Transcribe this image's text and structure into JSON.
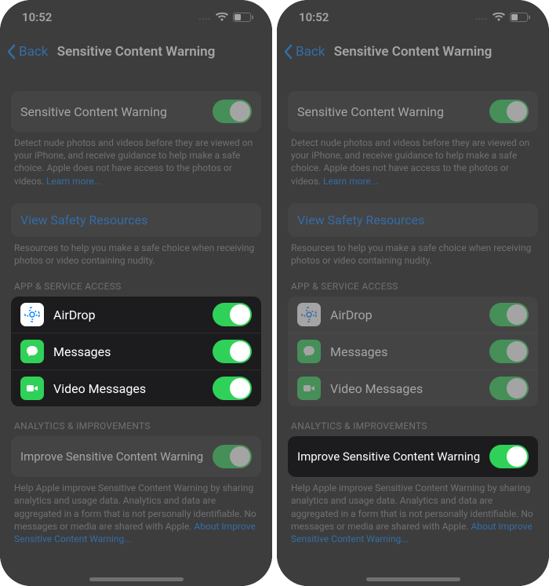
{
  "status": {
    "time": "10:52",
    "dots": "...."
  },
  "nav": {
    "back": "Back",
    "title": "Sensitive Content Warning"
  },
  "main_toggle": {
    "label": "Sensitive Content Warning",
    "on": true
  },
  "main_footer": {
    "text": "Detect nude photos and videos before they are viewed on your iPhone, and receive guidance to help make a safe choice. Apple does not have access to the photos or videos.",
    "link": "Learn more..."
  },
  "resources": {
    "label": "View Safety Resources",
    "footer": "Resources to help you make a safe choice when receiving photos or video containing nudity."
  },
  "apps_header": "APP & SERVICE ACCESS",
  "apps": [
    {
      "name": "AirDrop",
      "icon": "airdrop",
      "on": true
    },
    {
      "name": "Messages",
      "icon": "messages",
      "on": true
    },
    {
      "name": "Video Messages",
      "icon": "video",
      "on": true
    }
  ],
  "analytics_header": "ANALYTICS & IMPROVEMENTS",
  "analytics": {
    "label": "Improve Sensitive Content Warning",
    "on": true
  },
  "analytics_footer": {
    "text": "Help Apple improve Sensitive Content Warning by sharing analytics and usage data. Analytics and data are aggregated in a form that is not personally identifiable. No messages or media are shared with Apple.",
    "link": "About Improve Sensitive Content Warning..."
  }
}
